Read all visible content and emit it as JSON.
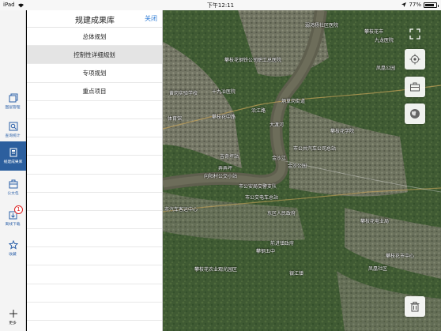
{
  "status_bar": {
    "device": "iPad",
    "time": "下午12:11",
    "battery": "77%"
  },
  "rail": {
    "items": [
      {
        "label": "图层管理",
        "icon": "layers-icon"
      },
      {
        "label": "查询统计",
        "icon": "search-stats-icon"
      },
      {
        "label": "规建成果库",
        "icon": "archive-icon"
      },
      {
        "label": "公文包",
        "icon": "briefcase-icon"
      },
      {
        "label": "离线下载",
        "icon": "download-icon",
        "badge": "1"
      },
      {
        "label": "收藏",
        "icon": "star-icon"
      }
    ],
    "more_label": "更多"
  },
  "panel": {
    "title": "规建成果库",
    "close_label": "关闭",
    "rows": [
      "总体规划",
      "控制性详细规划",
      "专项规划",
      "重点项目"
    ],
    "selected_index": 1
  },
  "map": {
    "labels": [
      "弱鸿杨社区医院",
      "攀枝花市",
      "九龙医院",
      "攀枝花钢铁公司职工总医院",
      "黄岗实验学校",
      "十九冶医院",
      "大渡河",
      "市公共汽车公司总站",
      "炳草岗街道",
      "攀枝花学院",
      "凤凰公园",
      "吉奇坪站",
      "弄弄坪",
      "金沙江",
      "金沙公园",
      "市公交电车总站",
      "向阳村公交小站",
      "市公安局交警支队",
      "市汽车客运中心",
      "东区人民政府",
      "攀枝花电业局",
      "前进镇政府",
      "攀枝花市中心",
      "攀钢五中",
      "体育馆",
      "凤凰社区",
      "沿江路",
      "攀枝花中路",
      "攀枝花农业观光园区",
      "银江镇"
    ]
  }
}
